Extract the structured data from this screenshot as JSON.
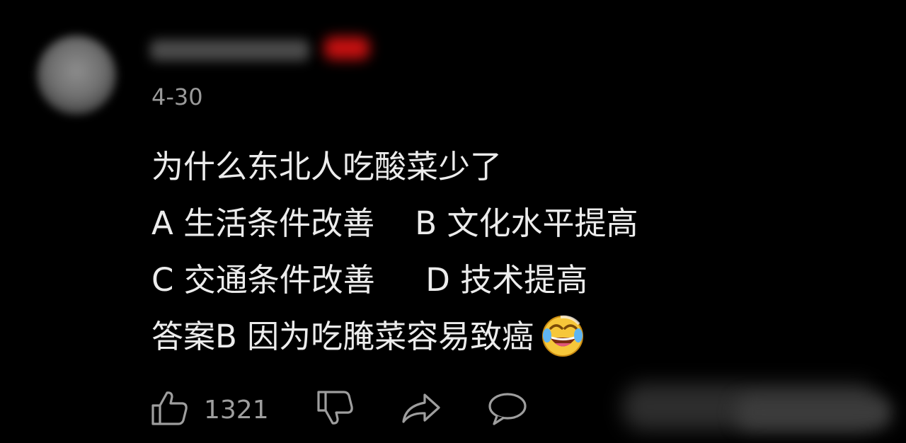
{
  "comment": {
    "date": "4-30",
    "lines": [
      "为什么东北人吃酸菜少了",
      "A 生活条件改善    B 文化水平提高",
      "C 交通条件改善     D 技术提高",
      "答案B 因为吃腌菜容易致癌"
    ],
    "emoji": "laughing-crying-emoji"
  },
  "actions": {
    "like_count": "1321",
    "icons": [
      "thumbs-up-icon",
      "thumbs-down-icon",
      "share-icon",
      "reply-icon"
    ]
  },
  "colors": {
    "background": "#000000",
    "text": "#ececec",
    "muted": "#9a9a9a",
    "badge": "#c61010"
  }
}
